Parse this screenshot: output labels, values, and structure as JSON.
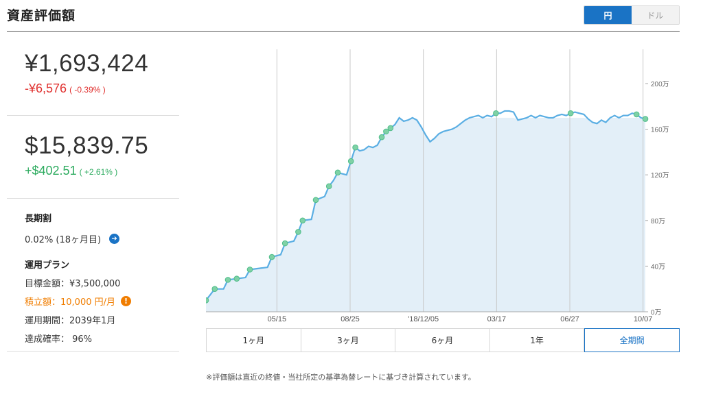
{
  "header": {
    "title": "資産評価額",
    "currency_options": [
      {
        "label": "円",
        "active": true
      },
      {
        "label": "ドル",
        "active": false
      }
    ]
  },
  "summary": {
    "yen": {
      "value": "¥1,693,424",
      "change": "-¥6,576",
      "change_pct": "( -0.39% )"
    },
    "usd": {
      "value": "$15,839.75",
      "change": "+$402.51",
      "change_pct": "( +2.61% )"
    }
  },
  "long_term_discount": {
    "heading": "長期割",
    "value": "0.02% (18ヶ月目)"
  },
  "plan": {
    "heading": "運用プラン",
    "target": "目標金額：¥3,500,000",
    "monthly": "積立額：10,000 円/月",
    "period": "運用期間：2039年1月",
    "probability": "達成確率： 96%"
  },
  "colors": {
    "accent": "#1a73c5",
    "negative": "#e0302e",
    "positive": "#2dab5f",
    "warning": "#f07d00",
    "line": "#5aaee3",
    "fill": "#e3eff8",
    "marker": "#7fd1a6"
  },
  "chart_data": {
    "type": "area",
    "x_ticks": [
      "05/15",
      "08/25",
      "'18/12/05",
      "03/17",
      "06/27",
      "10/07"
    ],
    "y_ticks": [
      "0万",
      "40万",
      "80万",
      "120万",
      "160万",
      "200万"
    ],
    "ylim": [
      0,
      2300000
    ],
    "x_range": [
      0,
      100
    ],
    "series": [
      {
        "points": [
          [
            0,
            100000
          ],
          [
            2,
            200000
          ],
          [
            4,
            200000
          ],
          [
            5,
            280000
          ],
          [
            7,
            290000
          ],
          [
            9,
            300000
          ],
          [
            10,
            370000
          ],
          [
            12,
            380000
          ],
          [
            14,
            390000
          ],
          [
            15,
            480000
          ],
          [
            17,
            500000
          ],
          [
            18,
            600000
          ],
          [
            20,
            620000
          ],
          [
            21,
            700000
          ],
          [
            22,
            800000
          ],
          [
            24,
            810000
          ],
          [
            25,
            980000
          ],
          [
            27,
            1010000
          ],
          [
            28,
            1100000
          ],
          [
            29,
            1150000
          ],
          [
            30,
            1220000
          ],
          [
            31,
            1210000
          ],
          [
            32,
            1200000
          ],
          [
            33,
            1320000
          ],
          [
            34,
            1440000
          ],
          [
            35,
            1410000
          ],
          [
            36,
            1420000
          ],
          [
            37,
            1450000
          ],
          [
            38,
            1440000
          ],
          [
            39,
            1460000
          ],
          [
            40,
            1530000
          ],
          [
            41,
            1580000
          ],
          [
            42,
            1610000
          ],
          [
            43,
            1640000
          ],
          [
            44,
            1700000
          ],
          [
            45,
            1670000
          ],
          [
            46,
            1680000
          ],
          [
            47,
            1700000
          ],
          [
            48,
            1680000
          ],
          [
            49,
            1620000
          ],
          [
            50,
            1550000
          ],
          [
            51,
            1490000
          ],
          [
            52,
            1520000
          ],
          [
            53,
            1560000
          ],
          [
            54,
            1580000
          ],
          [
            55,
            1590000
          ],
          [
            56,
            1600000
          ],
          [
            57,
            1620000
          ],
          [
            58,
            1650000
          ],
          [
            59,
            1680000
          ],
          [
            60,
            1700000
          ],
          [
            61,
            1710000
          ],
          [
            62,
            1720000
          ],
          [
            63,
            1700000
          ],
          [
            64,
            1720000
          ],
          [
            65,
            1710000
          ],
          [
            66,
            1740000
          ],
          [
            67,
            1740000
          ],
          [
            68,
            1760000
          ],
          [
            69,
            1760000
          ],
          [
            70,
            1750000
          ],
          [
            71,
            1680000
          ],
          [
            72,
            1690000
          ],
          [
            73,
            1700000
          ],
          [
            74,
            1720000
          ],
          [
            75,
            1700000
          ],
          [
            76,
            1720000
          ],
          [
            77,
            1710000
          ],
          [
            78,
            1700000
          ],
          [
            79,
            1700000
          ],
          [
            80,
            1720000
          ],
          [
            81,
            1730000
          ],
          [
            82,
            1720000
          ],
          [
            83,
            1740000
          ],
          [
            84,
            1750000
          ],
          [
            85,
            1740000
          ],
          [
            86,
            1730000
          ],
          [
            87,
            1690000
          ],
          [
            88,
            1660000
          ],
          [
            89,
            1650000
          ],
          [
            90,
            1680000
          ],
          [
            91,
            1660000
          ],
          [
            92,
            1700000
          ],
          [
            93,
            1720000
          ],
          [
            94,
            1700000
          ],
          [
            95,
            1720000
          ],
          [
            96,
            1720000
          ],
          [
            97,
            1740000
          ],
          [
            98,
            1730000
          ],
          [
            99,
            1700000
          ],
          [
            100,
            1690000
          ]
        ],
        "markers": [
          0,
          2,
          5,
          7,
          10,
          15,
          18,
          21,
          22,
          25,
          28,
          30,
          33,
          34,
          40,
          41,
          42,
          66,
          83,
          98,
          100
        ]
      }
    ],
    "reference_level": 1700000,
    "grid": true
  },
  "range_tabs": [
    {
      "label": "1ヶ月",
      "active": false
    },
    {
      "label": "3ヶ月",
      "active": false
    },
    {
      "label": "6ヶ月",
      "active": false
    },
    {
      "label": "1年",
      "active": false
    },
    {
      "label": "全期間",
      "active": true
    }
  ],
  "footnote": "※評価額は直近の終値・当社所定の基準為替レートに基づき計算されています。"
}
